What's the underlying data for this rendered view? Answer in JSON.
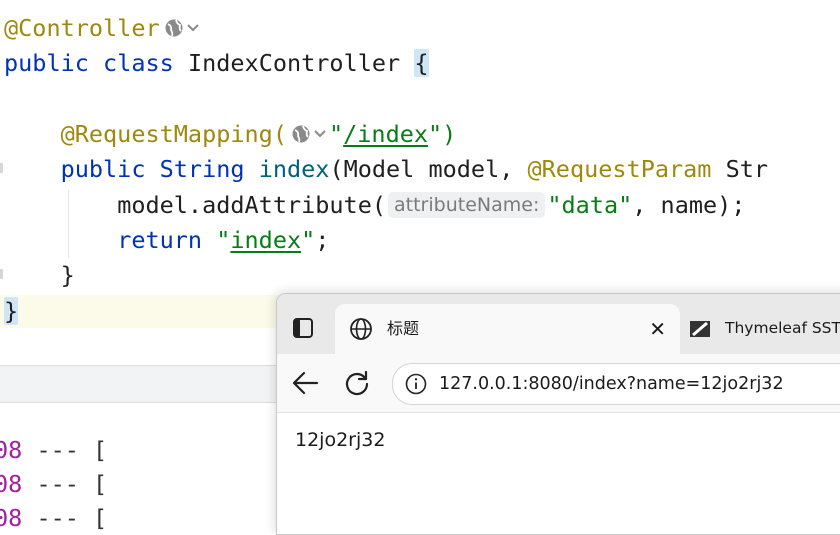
{
  "editor": {
    "lines": {
      "l1_annotation": "@Controller",
      "l2_public": "public",
      "l2_class": "class",
      "l2_name": "IndexController",
      "l2_brace": "{",
      "l4_annotation": "@RequestMapping(",
      "l4_quote_open": "\"",
      "l4_path": "/index",
      "l4_quote_close": "\")",
      "l5_public": "public",
      "l5_type": "String",
      "l5_method": "index",
      "l5_params": "(Model model, ",
      "l5_annotation": "@RequestParam",
      "l5_rest": " Str",
      "l6_call": "model.addAttribute(",
      "l6_hint": "attributeName:",
      "l6_arg": "\"data\"",
      "l6_rest": ", name);",
      "l7_return": "return",
      "l7_quote_open": "\"",
      "l7_value": "index",
      "l7_quote_close": "\"",
      "l7_semicolon": ";",
      "l8_brace": "}",
      "l9_brace": "}"
    },
    "icons": {
      "web_endpoint": "globe-icon",
      "chevron": "chevron-down-icon"
    }
  },
  "console": {
    "lines": [
      {
        "num": "08",
        "rest": " --- ["
      },
      {
        "num": "08",
        "rest": " --- ["
      },
      {
        "num": "08",
        "rest": " --- ["
      }
    ]
  },
  "browser": {
    "active_tab_title": "标题",
    "other_tab_title": "Thymeleaf SSTI",
    "url": "127.0.0.1:8080/index?name=12jo2rj32",
    "page_content": "12jo2rj32",
    "close_glyph": "✕"
  },
  "colors": {
    "keyword": "#0033b3",
    "annotation": "#9e880d",
    "string": "#067d17",
    "method": "#00627a",
    "console_number": "#a020a0"
  }
}
